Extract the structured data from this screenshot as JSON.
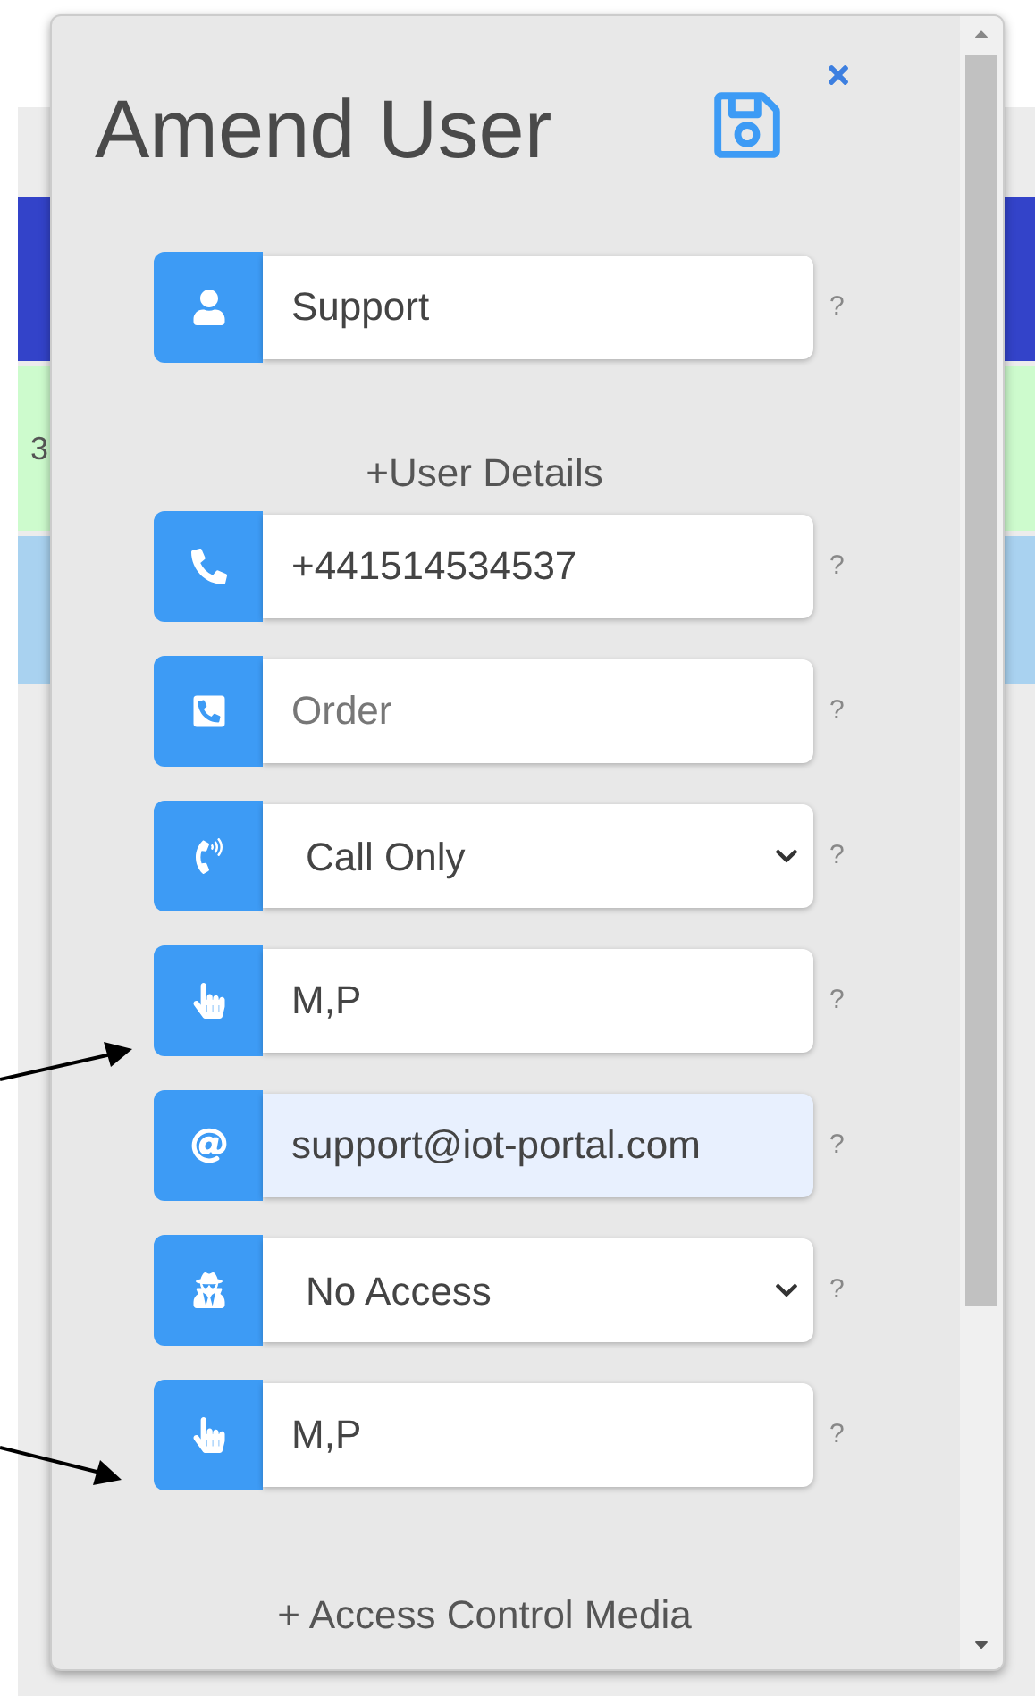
{
  "background": {
    "cell_text": "3"
  },
  "dialog": {
    "title": "Amend User",
    "fields": [
      {
        "kind": "text",
        "value": "Support",
        "autofilled": false,
        "help": "?"
      },
      {
        "kind": "section",
        "label": "+User Details"
      },
      {
        "kind": "text",
        "value": "+441514534537",
        "autofilled": false,
        "help": "?"
      },
      {
        "kind": "text",
        "placeholder": "Order",
        "autofilled": false,
        "help": "?"
      },
      {
        "kind": "select",
        "value": "Call Only",
        "help": "?"
      },
      {
        "kind": "text",
        "value": "M,P",
        "autofilled": false,
        "help": "?"
      },
      {
        "kind": "text",
        "value": "support@iot-portal.com",
        "autofilled": true,
        "help": "?"
      },
      {
        "kind": "select",
        "value": "No Access",
        "help": "?"
      },
      {
        "kind": "text",
        "value": "M,P",
        "autofilled": false,
        "help": "?"
      },
      {
        "kind": "section",
        "label": "+ Access Control Media"
      }
    ]
  }
}
